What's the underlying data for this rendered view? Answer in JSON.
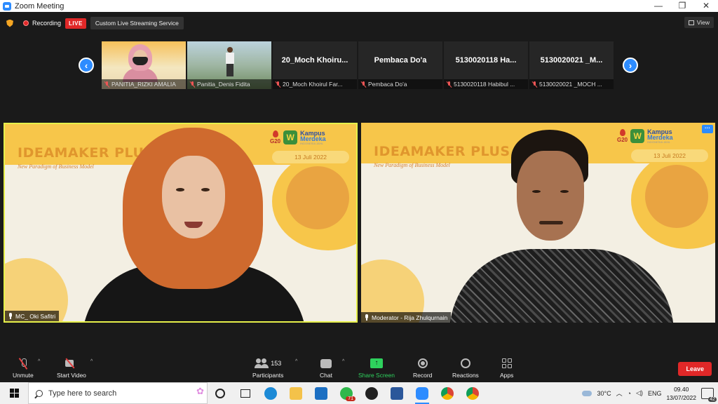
{
  "window": {
    "title": "Zoom Meeting",
    "controls": [
      "—",
      "❐",
      "✕"
    ]
  },
  "topbar": {
    "recording_label": "Recording",
    "live_badge": "LIVE",
    "stream_service": "Custom Live Streaming Service",
    "view_label": "View"
  },
  "thumbnails": [
    {
      "display": "",
      "caption": "PANITIA_RIZKI AMALIA"
    },
    {
      "display": "",
      "caption": "Panitia_Denis Fidita"
    },
    {
      "display": "20_Moch  Khoiru...",
      "caption": "20_Moch Khoirul Far..."
    },
    {
      "display": "Pembaca Do'a",
      "caption": "Pembaca Do'a"
    },
    {
      "display": "5130020118 Ha...",
      "caption": "5130020118 Habibul ..."
    },
    {
      "display": "5130020021 _M...",
      "caption": "5130020021 _MOCH ..."
    }
  ],
  "tiles": [
    {
      "title": "IDEAMAKER PLUS",
      "subtitle": "New Paradigm of Business Model",
      "date": "13 Juli 2022",
      "logo_g20": "G20",
      "logo_km_1": "Kampus",
      "logo_km_2": "Merdeka",
      "logo_km_3": "INDONESIA JAYA",
      "caption": "MC_ Oki Safitri"
    },
    {
      "title": "IDEAMAKER PLUS",
      "subtitle": "New Paradigm of Business Model",
      "date": "13 Juli 2022",
      "logo_g20": "G20",
      "logo_km_1": "Kampus",
      "logo_km_2": "Merdeka",
      "logo_km_3": "INDONESIA JAYA",
      "caption": "Moderator - Rija  Zhulqurnain",
      "more": "···"
    }
  ],
  "toolbar": {
    "unmute": "Unmute",
    "start_video": "Start Video",
    "participants": "Participants",
    "participant_count": "153",
    "chat": "Chat",
    "share_screen": "Share Screen",
    "record": "Record",
    "reactions": "Reactions",
    "apps": "Apps",
    "leave": "Leave",
    "caret": "^",
    "share_arrow": "↑"
  },
  "taskbar": {
    "search_placeholder": "Type here to search",
    "whatsapp_badge": "71",
    "temperature": "30°C",
    "language": "ENG",
    "time": "09.40",
    "date": "13/07/2022",
    "notifications": "42"
  },
  "colors": {
    "accent": "#2d8cff",
    "live": "#e02828",
    "share": "#2ed15d",
    "slide_yellow": "#f7c64a",
    "slide_orange": "#e0962d"
  }
}
